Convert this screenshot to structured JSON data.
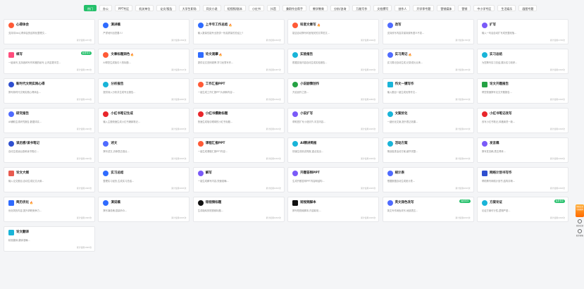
{
  "tabs": [
    "热门",
    "办公",
    "PPT专区",
    "机关单位",
    "论文/报告",
    "大学生职场",
    "同文小说",
    "短视频/剧本",
    "小红书",
    "抖音",
    "兼职作业帮手",
    "教学教育",
    "分析/咨询",
    "万能写作",
    "文档撰写",
    "创作人",
    "开学季专题",
    "营销媒体",
    "营销",
    "中小学专区",
    "生活娱乐",
    "画图专题"
  ],
  "active_tab": "热门",
  "cards": [
    {
      "title": "心得体会",
      "desc": "支持将list心得体会的结构化整理文...",
      "usage": "累计使用1073次",
      "icon": "heart-icon",
      "color": "#ff5a36",
      "shape": "round",
      "hot": false,
      "badge": ""
    },
    {
      "title": "演讲稿",
      "desc": "严谨地列出您要人!",
      "usage": "累计使用1394次",
      "icon": "mic-icon",
      "color": "#2f6bff",
      "shape": "round",
      "hot": false,
      "badge": ""
    },
    {
      "title": "上半年工作总结",
      "desc": "输入数量仅能专业提供一份高质量的总结上?",
      "usage": "累计使用1093次",
      "icon": "doc-icon",
      "color": "#2f6bff",
      "shape": "round",
      "hot": true,
      "badge": ""
    },
    {
      "title": "科室文章写",
      "desc": "能否自动撰写科室相关的文章范文...",
      "usage": "累计使用1094次",
      "icon": "write-icon",
      "color": "#ff5a36",
      "shape": "round",
      "hot": true,
      "badge": ""
    },
    {
      "title": "改写",
      "desc": "支持改写内容并保持原有语义不变...",
      "usage": "累计使用1783次",
      "icon": "pen-icon",
      "color": "#4f6bff",
      "shape": "round",
      "hot": false,
      "badge": ""
    },
    {
      "title": "扩写",
      "desc": "输入一句话自动扩写成完整段落...",
      "usage": "累计使用1783次",
      "icon": "expand-icon",
      "color": "#7a5af8",
      "shape": "round",
      "hot": false,
      "badge": ""
    },
    {
      "title": "续写",
      "desc": "一键续写,支持各种写作风格的续写,让内容更丰富...",
      "usage": "累计使用1383次",
      "icon": "continue-icon",
      "color": "#ff4d7d",
      "shape": "sq",
      "hot": false,
      "badge": "会员专享"
    },
    {
      "title": "文章标题润色",
      "desc": "AI帮您生成吸引人的标题...",
      "usage": "累计使用1547次",
      "icon": "title-icon",
      "color": "#ff5a36",
      "shape": "round",
      "hot": true,
      "badge": ""
    },
    {
      "title": "论文观摩",
      "desc": "提供论文范例观摩,学习优秀写作...",
      "usage": "累计使用1087次",
      "icon": "book-icon",
      "color": "#2f6bff",
      "shape": "sq",
      "hot": true,
      "badge": ""
    },
    {
      "title": "实验报告",
      "desc": "根据实验内容自动生成实验报告...",
      "usage": "累计使用1093次",
      "icon": "flask-icon",
      "color": "#19b4d8",
      "shape": "round",
      "hot": false,
      "badge": ""
    },
    {
      "title": "实习周记",
      "desc": "实习周记自动生成,记录成长点滴...",
      "usage": "累计使用1283次",
      "icon": "note-icon",
      "color": "#4f6bff",
      "shape": "round",
      "hot": true,
      "badge": ""
    },
    {
      "title": "实习总结",
      "desc": "为您撰写实习总结,展示实习收获...",
      "usage": "累计使用1093次",
      "icon": "summary-icon",
      "color": "#19b4d8",
      "shape": "round",
      "hot": false,
      "badge": ""
    },
    {
      "title": "新时代文明实践心得",
      "desc": "撰写新时代文明实践心得体会...",
      "usage": "累计使用1079次",
      "icon": "flag-icon",
      "color": "#2f4fcf",
      "shape": "round",
      "hot": false,
      "badge": ""
    },
    {
      "title": "分析报告",
      "desc": "提供深入分析并生成专业报告...",
      "usage": "累计使用1083次",
      "icon": "chart-icon",
      "color": "#19b4d8",
      "shape": "round",
      "hot": false,
      "badge": ""
    },
    {
      "title": "工作汇报PPT",
      "desc": "一键生成工作汇报PPT大纲和内容...",
      "usage": "累计使用1094次",
      "icon": "ppt-icon",
      "color": "#ff5a36",
      "shape": "round",
      "hot": false,
      "badge": ""
    },
    {
      "title": "小说剧情创作",
      "desc": "开启创作之旅...",
      "usage": "累计使用1083次",
      "icon": "story-icon",
      "color": "#25a244",
      "shape": "round",
      "hot": false,
      "badge": ""
    },
    {
      "title": "作文一键写作",
      "desc": "输入题目一键生成优秀作文...",
      "usage": "累计使用1093次",
      "icon": "essay-icon",
      "color": "#19b4d8",
      "shape": "sq",
      "hot": false,
      "badge": ""
    },
    {
      "title": "论文开题报告",
      "desc": "帮您快速撰写论文开题报告...",
      "usage": "累计使用1093次",
      "icon": "paper-icon",
      "color": "#25a244",
      "shape": "sq",
      "hot": false,
      "badge": ""
    },
    {
      "title": "研究报告",
      "desc": "AI辅助生成研究报告,数据详实...",
      "usage": "累计使用1093次",
      "icon": "research-icon",
      "color": "#4f6bff",
      "shape": "round",
      "hot": false,
      "badge": ""
    },
    {
      "title": "小红书笔记生成",
      "desc": "输入主题快速生成小红书爆款笔记...",
      "usage": "累计使用1093次",
      "icon": "xhs-icon",
      "color": "#e8262b",
      "shape": "round",
      "hot": false,
      "badge": ""
    },
    {
      "title": "小红书爆款标题",
      "desc": "快速生成吸引眼球的小红书标题...",
      "usage": "累计使用1093次",
      "icon": "xhs-icon",
      "color": "#e8262b",
      "shape": "round",
      "hot": false,
      "badge": ""
    },
    {
      "title": "小说扩写",
      "desc": "帮助您扩写小说情节,丰富内容...",
      "usage": "累计使用1093次",
      "icon": "novel-icon",
      "color": "#7a5af8",
      "shape": "round",
      "hot": false,
      "badge": ""
    },
    {
      "title": "文案优化",
      "desc": "一键优化文案,提升表达效果...",
      "usage": "累计使用1093次",
      "icon": "copy-icon",
      "color": "#19b4d8",
      "shape": "round",
      "hot": false,
      "badge": ""
    },
    {
      "title": "小红书笔记改写",
      "desc": "改写小红书笔记,风格焕然一新...",
      "usage": "累计使用1093次",
      "icon": "xhs-icon",
      "color": "#e8262b",
      "shape": "round",
      "hot": false,
      "badge": ""
    },
    {
      "title": "读后感/读书笔记",
      "desc": "自动生成读后感和读书笔记...",
      "usage": "累计使用1093次",
      "icon": "read-icon",
      "color": "#2f4fcf",
      "shape": "round",
      "hot": false,
      "badge": ""
    },
    {
      "title": "述文",
      "desc": "撰写述文,清晰表达观点...",
      "usage": "累计使用1093次",
      "icon": "article-icon",
      "color": "#4f6bff",
      "shape": "round",
      "hot": false,
      "badge": ""
    },
    {
      "title": "课程汇报PPT",
      "desc": "一键生成课程汇报PPT内容...",
      "usage": "累计使用1093次",
      "icon": "ppt-icon",
      "color": "#ff5a36",
      "shape": "round",
      "hot": false,
      "badge": ""
    },
    {
      "title": "AI精讲简报",
      "desc": "快速生成精讲简报,重点突出...",
      "usage": "累计使用1093次",
      "icon": "brief-icon",
      "color": "#19b4d8",
      "shape": "round",
      "hot": false,
      "badge": ""
    },
    {
      "title": "活动方案",
      "desc": "策划各类活动方案,细节完整...",
      "usage": "累计使用1093次",
      "icon": "plan-icon",
      "color": "#19b4d8",
      "shape": "round",
      "hot": false,
      "badge": ""
    },
    {
      "title": "发言稿",
      "desc": "撰写发言稿,表达得体...",
      "usage": "累计使用1093次",
      "icon": "speech-icon",
      "color": "#7a5af8",
      "shape": "round",
      "hot": false,
      "badge": ""
    },
    {
      "title": "论文大纲",
      "desc": "输入论文题目,自动生成论文大纲...",
      "usage": "累计使用1093次",
      "icon": "outline-icon",
      "color": "#e85a4f",
      "shape": "sq",
      "hot": false,
      "badge": ""
    },
    {
      "title": "实习总结",
      "desc": "整理实习经历,生成实习总结...",
      "usage": "累计使用1093次",
      "icon": "summary-icon",
      "color": "#2f6bff",
      "shape": "round",
      "hot": false,
      "badge": ""
    },
    {
      "title": "解写",
      "desc": "一键生成解写内容,快速准确...",
      "usage": "累计使用1093次",
      "icon": "decode-icon",
      "color": "#7a5af8",
      "shape": "round",
      "hot": false,
      "badge": ""
    },
    {
      "title": "开题答辩PPT",
      "desc": "生成开题答辩PPT内容和结构...",
      "usage": "累计使用1093次",
      "icon": "ppt-icon",
      "color": "#7a5af8",
      "shape": "round",
      "hot": false,
      "badge": ""
    },
    {
      "title": "统计表",
      "desc": "根据数据自动生成统计表...",
      "usage": "累计使用1093次",
      "icon": "table-icon",
      "color": "#4f6bff",
      "shape": "round",
      "hot": false,
      "badge": ""
    },
    {
      "title": "网络计划书写作",
      "desc": "帮助撰写网络计划书,结构清晰...",
      "usage": "累计使用1093次",
      "icon": "network-icon",
      "color": "#2f4fcf",
      "shape": "sq",
      "hot": false,
      "badge": ""
    },
    {
      "title": "简历优化",
      "desc": "优化简历内容,提升求职竞争力...",
      "usage": "累计使用1093次",
      "icon": "resume-icon",
      "color": "#2f6bff",
      "shape": "sq",
      "hot": true,
      "badge": ""
    },
    {
      "title": "演说稿",
      "desc": "撰写演说稿,感染听众...",
      "usage": "累计使用1093次",
      "icon": "talk-icon",
      "color": "#2f6bff",
      "shape": "round",
      "hot": false,
      "badge": ""
    },
    {
      "title": "短视频标题",
      "desc": "生成吸睛的短视频标题...",
      "usage": "累计使用1093次",
      "icon": "tiktok-icon",
      "color": "#111",
      "shape": "round",
      "hot": false,
      "badge": ""
    },
    {
      "title": "短视频脚本",
      "desc": "撰写短视频脚本,内容精彩...",
      "usage": "累计使用1093次",
      "icon": "tiktok-icon",
      "color": "#111",
      "shape": "sq",
      "hot": false,
      "badge": ""
    },
    {
      "title": "英文润色改写",
      "desc": "英文写作润色改写,地道表达...",
      "usage": "累计使用1093次",
      "icon": "english-icon",
      "color": "#4f6bff",
      "shape": "round",
      "hot": false,
      "badge": "会员专享"
    },
    {
      "title": "方案论证",
      "desc": "论证方案可行性,逻辑严密...",
      "usage": "累计使用1093次",
      "icon": "proof-icon",
      "color": "#19b4d8",
      "shape": "round",
      "hot": false,
      "badge": "会员专享"
    },
    {
      "title": "论文翻译",
      "desc": "精准翻译,翻译准确...",
      "usage": "累计使用1093次",
      "icon": "translate-icon",
      "color": "#19b4d8",
      "shape": "sq",
      "hot": false,
      "badge": ""
    }
  ],
  "side": {
    "promo": "领取会员专属福利",
    "btn1": "意见反馈",
    "btn2": "联系客服"
  }
}
